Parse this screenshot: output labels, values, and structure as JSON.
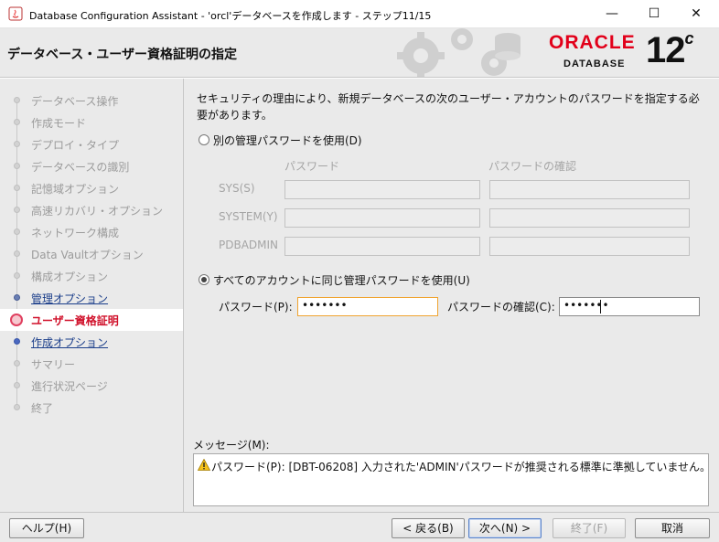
{
  "window": {
    "title": "Database Configuration Assistant - 'orcl'データベースを作成します - ステップ11/15",
    "minimize_glyph": "—",
    "maximize_glyph": "☐",
    "close_glyph": "✕"
  },
  "banner": {
    "heading": "データベース・ユーザー資格証明の指定",
    "logo_brand": "ORACLE",
    "logo_product": "DATABASE",
    "logo_version": "12",
    "logo_version_suffix": "c"
  },
  "nav": {
    "items": [
      {
        "label": "データベース操作",
        "state": "done"
      },
      {
        "label": "作成モード",
        "state": "done"
      },
      {
        "label": "デプロイ・タイプ",
        "state": "done"
      },
      {
        "label": "データベースの識別",
        "state": "done"
      },
      {
        "label": "記憶域オプション",
        "state": "done"
      },
      {
        "label": "高速リカバリ・オプション",
        "state": "done"
      },
      {
        "label": "ネットワーク構成",
        "state": "done"
      },
      {
        "label": "Data Vaultオプション",
        "state": "done"
      },
      {
        "label": "構成オプション",
        "state": "done"
      },
      {
        "label": "管理オプション",
        "state": "link"
      },
      {
        "label": "ユーザー資格証明",
        "state": "active"
      },
      {
        "label": "作成オプション",
        "state": "link"
      },
      {
        "label": "サマリー",
        "state": "todo"
      },
      {
        "label": "進行状況ページ",
        "state": "todo"
      },
      {
        "label": "終了",
        "state": "todo"
      }
    ]
  },
  "main": {
    "description": "セキュリティの理由により、新規データベースの次のユーザー・アカウントのパスワードを指定する必要があります。",
    "option_separate": "別の管理パスワードを使用(D)",
    "col_password": "パスワード",
    "col_confirm": "パスワードの確認",
    "rows": [
      {
        "label": "SYS(S)"
      },
      {
        "label": "SYSTEM(Y)"
      },
      {
        "label": "PDBADMIN"
      }
    ],
    "option_same": "すべてのアカウントに同じ管理パスワードを使用(U)",
    "same_password_label": "パスワード(P):",
    "same_password_value": "•••••••",
    "same_confirm_label": "パスワードの確認(C):",
    "same_confirm_value": "•••••••",
    "messages_label": "メッセージ(M):",
    "message_text": "パスワード(P): [DBT-06208] 入力された'ADMIN'パスワードが推奨される標準に準拠していません。"
  },
  "buttons": {
    "help": "ヘルプ(H)",
    "back": "< 戻る(B)",
    "next": "次へ(N) >",
    "finish": "終了(F)",
    "cancel": "取消"
  },
  "colors": {
    "active_step": "#d0102a",
    "link_step": "#1b3e8a",
    "oracle_red": "#e2001a"
  }
}
